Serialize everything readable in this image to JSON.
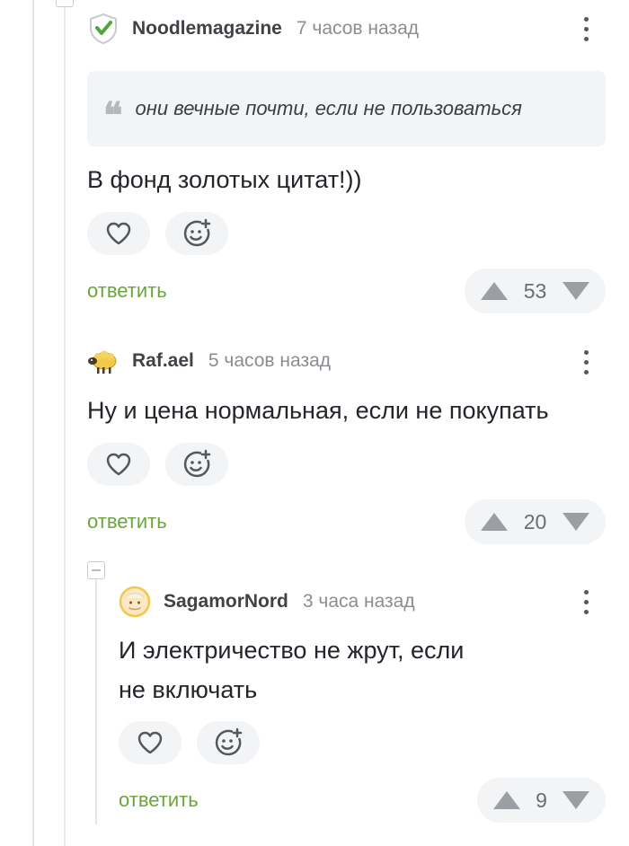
{
  "comments": [
    {
      "author": "Noodlemagazine",
      "time": "7 часов назад",
      "avatar_icon": "verified-shield-icon",
      "quote": "они вечные почти, если не пользоваться",
      "text": "В фонд золотых цитат!))",
      "reply_label": "ответить",
      "rating": "53"
    },
    {
      "author": "Raf.ael",
      "time": "5 часов назад",
      "avatar_icon": "sheep-avatar-icon",
      "text": "Ну и цена нормальная, если не покупать",
      "reply_label": "ответить",
      "rating": "20"
    },
    {
      "author": "SagamorNord",
      "time": "3 часа назад",
      "avatar_icon": "face-avatar-icon",
      "text_line1": "И электричество не жрут, если",
      "text_line2": "не включать",
      "reply_label": "ответить",
      "rating": "9"
    }
  ],
  "colors": {
    "reply": "#6aa63b",
    "shield": "#4ca63a",
    "pill_bg": "#f3f4f6"
  }
}
